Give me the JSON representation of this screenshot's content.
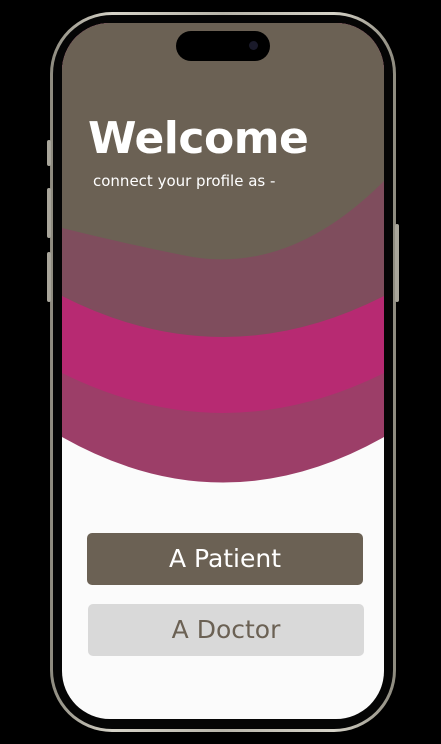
{
  "welcome": {
    "title": "Welcome",
    "subtitle": "connect your profile as -"
  },
  "options": {
    "patient_label": "A Patient",
    "doctor_label": "A Doctor"
  },
  "colors": {
    "brown": "#6b6154",
    "mauve": "#7f4d5d",
    "magenta": "#b72a72",
    "rose": "#9c3e68",
    "button_light": "#d9d9d9",
    "screen_bg": "#fbfbfb"
  }
}
